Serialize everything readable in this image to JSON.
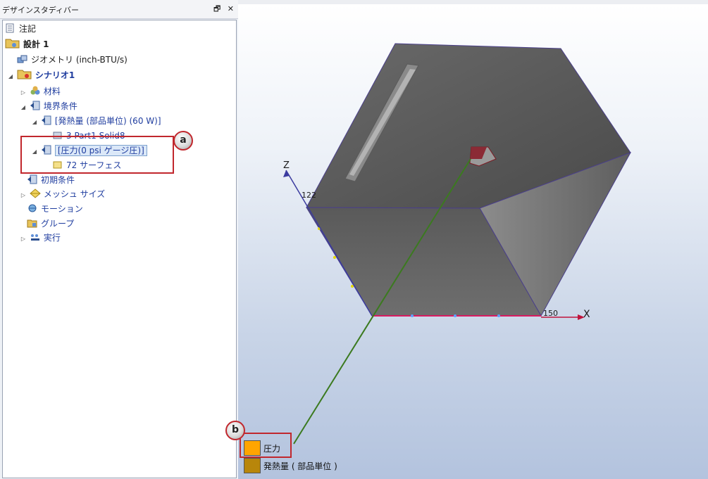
{
  "pane": {
    "title": "デザインスタディバー",
    "dock_glyph": "🗗",
    "close_glyph": "✕"
  },
  "tree": {
    "items": [
      {
        "label": "注記",
        "icon": "note-icon",
        "expander": ""
      },
      {
        "label": "設計 1",
        "icon": "design-folder-icon",
        "expander": ""
      },
      {
        "label": "ジオメトリ (inch-BTU/s)",
        "icon": "geometry-icon",
        "expander": ""
      },
      {
        "label": "シナリオ1",
        "icon": "scenario-folder-icon",
        "expander": "◢"
      },
      {
        "label": "材料",
        "icon": "materials-icon",
        "expander": "▷"
      },
      {
        "label": "境界条件",
        "icon": "boundary-icon",
        "expander": "◢"
      },
      {
        "label": "[発熱量 (部品単位) (60 W)]",
        "icon": "boundary-icon",
        "expander": "◢"
      },
      {
        "label": "3 Part1 Solid8",
        "icon": "part-icon",
        "expander": ""
      },
      {
        "label": "[圧力(0 psi ゲージ圧)]",
        "icon": "boundary-icon",
        "expander": "◢"
      },
      {
        "label": "72 サーフェス",
        "icon": "surface-icon",
        "expander": ""
      },
      {
        "label": "初期条件",
        "icon": "boundary-icon",
        "expander": ""
      },
      {
        "label": "メッシュ サイズ",
        "icon": "mesh-icon",
        "expander": "▷"
      },
      {
        "label": "モーション",
        "icon": "motion-icon",
        "expander": ""
      },
      {
        "label": "グループ",
        "icon": "group-icon",
        "expander": ""
      },
      {
        "label": "実行",
        "icon": "run-icon",
        "expander": "▷"
      }
    ]
  },
  "callouts": {
    "a": "a",
    "b": "b"
  },
  "viewport": {
    "axis_z": "Z",
    "axis_x": "X",
    "z_tick": "122",
    "x_tick": "150"
  },
  "legend": {
    "items": [
      {
        "label": "圧力",
        "color": "#ffa500"
      },
      {
        "label": "発熱量 ( 部品単位 )",
        "color": "#b8860b"
      }
    ]
  }
}
